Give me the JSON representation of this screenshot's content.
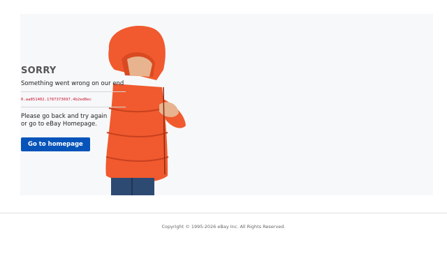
{
  "error": {
    "title": "SORRY",
    "message": "Something went wrong on our end",
    "reference_code": "0.aa851402.1787373697.4b2ed8ec",
    "help_line1": "Please go back and try again",
    "help_line2": "or go to eBay Homepage.",
    "button_label": "Go to homepage"
  },
  "footer": {
    "copyright": "Copyright © 1995-2026 eBay Inc. All Rights Reserved."
  },
  "colors": {
    "accent": "#0654ba",
    "panel_bg": "#f7f8fa",
    "jacket": "#f05a2e",
    "error_code": "#c8102e"
  }
}
